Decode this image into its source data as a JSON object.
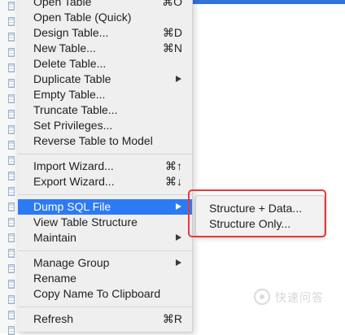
{
  "menu": {
    "items": [
      {
        "label": "Open Table",
        "shortcut": "⌘O"
      },
      {
        "label": "Open Table (Quick)",
        "shortcut": ""
      },
      {
        "label": "Design Table...",
        "shortcut": "⌘D"
      },
      {
        "label": "New Table...",
        "shortcut": "⌘N"
      },
      {
        "label": "Delete Table...",
        "shortcut": ""
      },
      {
        "label": "Duplicate Table",
        "shortcut": ""
      },
      {
        "label": "Empty Table...",
        "shortcut": ""
      },
      {
        "label": "Truncate Table...",
        "shortcut": ""
      },
      {
        "label": "Set Privileges...",
        "shortcut": ""
      },
      {
        "label": "Reverse Table to Model",
        "shortcut": ""
      },
      {
        "label": "Import Wizard...",
        "shortcut": "⌘↑"
      },
      {
        "label": "Export Wizard...",
        "shortcut": "⌘↓"
      },
      {
        "label": "Dump SQL File",
        "shortcut": ""
      },
      {
        "label": "View Table Structure",
        "shortcut": ""
      },
      {
        "label": "Maintain",
        "shortcut": ""
      },
      {
        "label": "Manage Group",
        "shortcut": ""
      },
      {
        "label": "Rename",
        "shortcut": ""
      },
      {
        "label": "Copy Name To Clipboard",
        "shortcut": ""
      },
      {
        "label": "Refresh",
        "shortcut": "⌘R"
      }
    ],
    "selected": "Dump SQL File"
  },
  "submenu": {
    "items": [
      {
        "label": "Structure + Data..."
      },
      {
        "label": "Structure Only..."
      }
    ]
  },
  "watermark": {
    "text": "快速问答"
  },
  "colors": {
    "selection": "#2d7bf4",
    "highlight_box": "#e53a3a",
    "menu_bg": "#efefef",
    "top_bar": "#2f74d6"
  }
}
